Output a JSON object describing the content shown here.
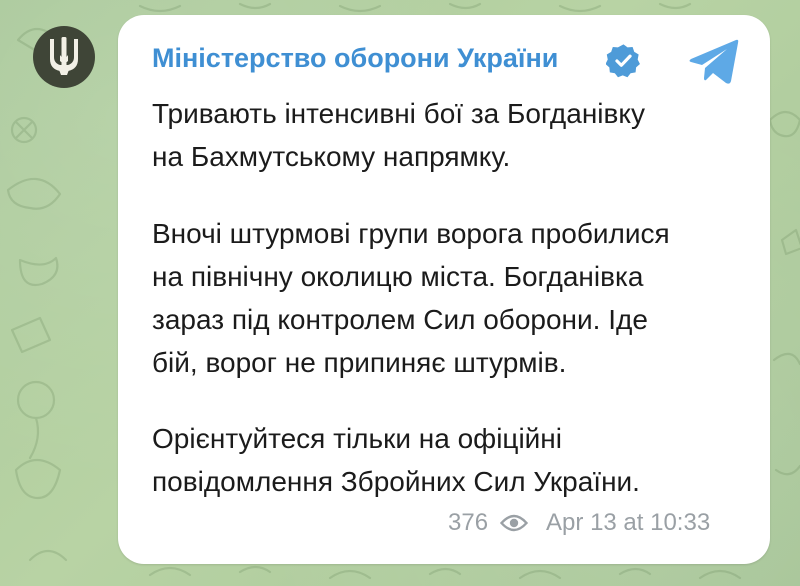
{
  "post": {
    "channel_name": "Міністерство оборони України",
    "paragraphs": [
      {
        "lines": [
          "Тривають інтенсивні бої за Богданівку",
          "на Бахмутському напрямку."
        ]
      },
      {
        "lines": [
          "Вночі штурмові групи ворога пробилися",
          "на північну околицю міста. Богданівка",
          "зараз під контролем Сил оборони. Іде",
          "бій, ворог не припиняє штурмів."
        ]
      },
      {
        "lines": [
          "Орієнтуйтеся тільки на офіційні",
          "повідомлення Збройних Сил України."
        ]
      }
    ],
    "views": "376",
    "timestamp": "Apr 13 at 10:33"
  },
  "icons": {
    "avatar": "trident-emblem-icon",
    "verified": "verified-badge-icon",
    "share": "telegram-share-icon",
    "views": "eye-icon"
  },
  "colors": {
    "channel_name": "#3f8fd3",
    "verified_badge": "#4e9bd8",
    "telegram_icon": "#5ea9e6",
    "meta_text": "#9aa0a5",
    "body_text": "#1b1b1b",
    "background": "#a9c79a",
    "avatar_bg": "#3f4537"
  }
}
